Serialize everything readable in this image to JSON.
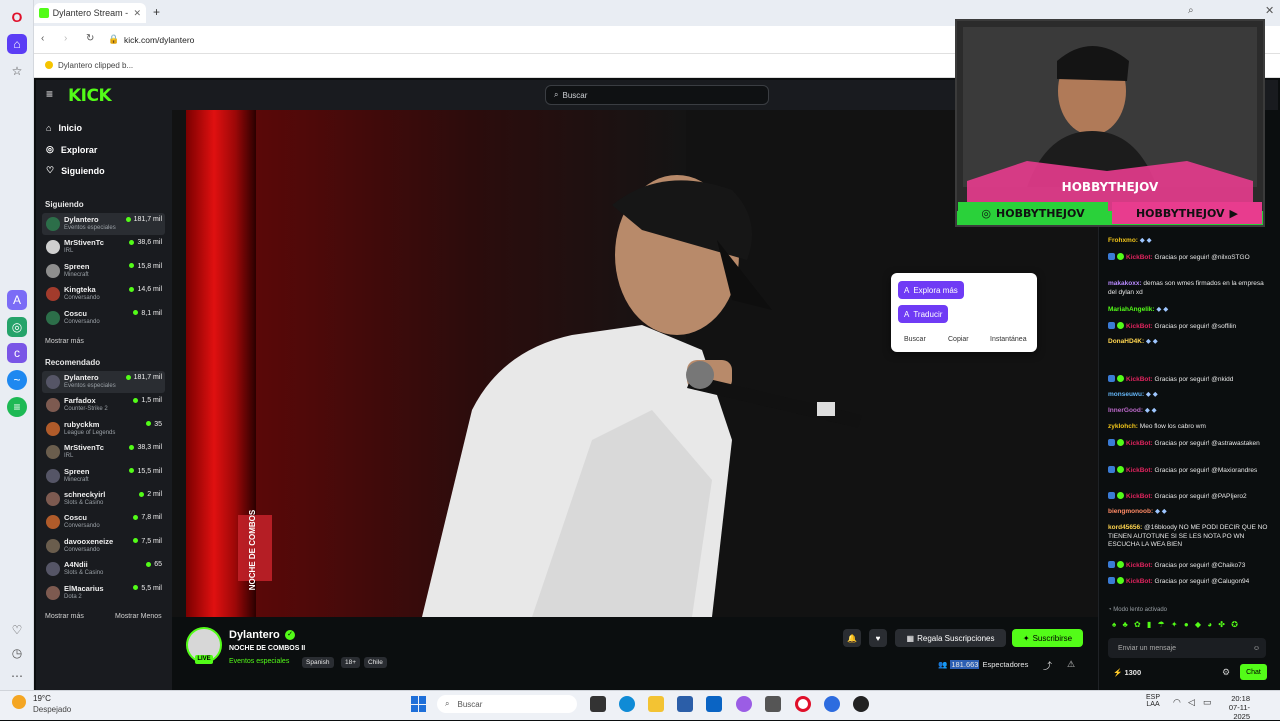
{
  "browser": {
    "tab_title": "Dylantero Stream - W",
    "url": "kick.com/dylantero",
    "bookmark": "Dylantero clipped b..."
  },
  "kick": {
    "logo": "KICK",
    "search_placeholder": "Buscar",
    "nav": [
      "Inicio",
      "Explorar",
      "Siguiendo"
    ],
    "following_title": "Siguiendo",
    "following": [
      {
        "name": "Dylantero",
        "category": "Eventos especiales",
        "viewers": "181,7 mil"
      },
      {
        "name": "MrStivenTc",
        "category": "IRL",
        "viewers": "38,6 mil"
      },
      {
        "name": "Spreen",
        "category": "Minecraft",
        "viewers": "15,8 mil"
      },
      {
        "name": "Kingteka",
        "category": "Conversando",
        "viewers": "14,6 mil"
      },
      {
        "name": "Coscu",
        "category": "Conversando",
        "viewers": "8,1 mil"
      }
    ],
    "show_more": "Mostrar más",
    "recommended_title": "Recomendado",
    "recommended": [
      {
        "name": "Dylantero",
        "category": "Eventos especiales",
        "viewers": "181,7 mil"
      },
      {
        "name": "Farfadox",
        "category": "Counter-Strike 2",
        "viewers": "1,5 mil"
      },
      {
        "name": "rubyckkm",
        "category": "League of Legends",
        "viewers": "35"
      },
      {
        "name": "MrStivenTc",
        "category": "IRL",
        "viewers": "38,3 mil"
      },
      {
        "name": "Spreen",
        "category": "Minecraft",
        "viewers": "15,5 mil"
      },
      {
        "name": "schneckyirl",
        "category": "Slots & Casino",
        "viewers": "2 mil"
      },
      {
        "name": "Coscu",
        "category": "Conversando",
        "viewers": "7,8 mil"
      },
      {
        "name": "davooxeneize",
        "category": "Conversando",
        "viewers": "7,5 mil"
      },
      {
        "name": "A4Ndii",
        "category": "Slots & Casino",
        "viewers": "65"
      },
      {
        "name": "ElMacarius",
        "category": "Dota 2",
        "viewers": "5,5 mil"
      }
    ],
    "show_more_2": "Mostrar más",
    "show_less": "Mostrar Menos"
  },
  "context_menu": {
    "explore": "Explora más",
    "translate": "Traducir",
    "search": "Buscar",
    "copy": "Copiar",
    "snapshot": "Instantánea"
  },
  "webcam": {
    "handle_left": "HOBBYTHEJOV",
    "handle_right": "HOBBYTHEJOV",
    "handle_top": "HOBBYTHEJOV"
  },
  "video": {
    "overlay_text": "NOCHE DE COMBOS"
  },
  "stream": {
    "streamer": "Dylantero",
    "title": "NOCHE DE COMBOS II",
    "live": "LIVE",
    "category": "Eventos especiales",
    "tags": [
      "Spanish",
      "18+",
      "Chile"
    ],
    "gift_subs": "Regala Suscripciones",
    "subscribe": "Suscribirse",
    "viewers": "181.663",
    "viewers_label": "Espectadores"
  },
  "chat": {
    "messages": [
      {
        "user": "Frohxmo",
        "text": ""
      },
      {
        "user": "KickBot",
        "text": "Gracias por seguir! @nilxoSTGO"
      },
      {
        "user": "makakoxx",
        "text": "demas son wmes firmados en la empresa del dylan xd"
      },
      {
        "user": "MariahAngelik",
        "text": ""
      },
      {
        "user": "KickBot",
        "text": "Gracias por seguir! @soffilin"
      },
      {
        "user": "DonaHD4K",
        "text": ""
      },
      {
        "user": "KickBot",
        "text": "Gracias por seguir! @nkidd"
      },
      {
        "user": "monseuwu",
        "text": ""
      },
      {
        "user": "InnerGood",
        "text": ""
      },
      {
        "user": "zyklohch",
        "text": "Meo flow los cabro wm"
      },
      {
        "user": "KickBot",
        "text": "Gracias por seguir! @astrawastaken"
      },
      {
        "user": "KickBot",
        "text": "Gracias por seguir! @Maxiorandres"
      },
      {
        "user": "KickBot",
        "text": "Gracias por seguir! @PAPIjero2"
      },
      {
        "user": "biengmonoob",
        "text": ""
      },
      {
        "user": "kord45656",
        "text": "@16bloody NO ME PODI DECIR QUE NO TIENEN AUTOTUNE SI SE LES NOTA PO WN ESCUCHA LA WEA BIEN"
      },
      {
        "user": "KickBot",
        "text": "Gracias por seguir! @Chaiko73"
      },
      {
        "user": "KickBot",
        "text": "Gracias por seguir! @Calugon94"
      }
    ],
    "slow_mode": "Modo lento activado",
    "input_placeholder": "Enviar un mensaje",
    "points": "1300",
    "chat_button": "Chat"
  },
  "taskbar": {
    "weather_temp": "19°C",
    "weather_desc": "Despejado",
    "search": "Buscar",
    "lang": "ESP",
    "lang2": "LAA",
    "time": "20:18",
    "date": "07-11-2025"
  },
  "colors": {
    "kick_green": "#53fc18",
    "context_purple": "#6f3bf5",
    "kickbot_red": "#e0245e"
  }
}
